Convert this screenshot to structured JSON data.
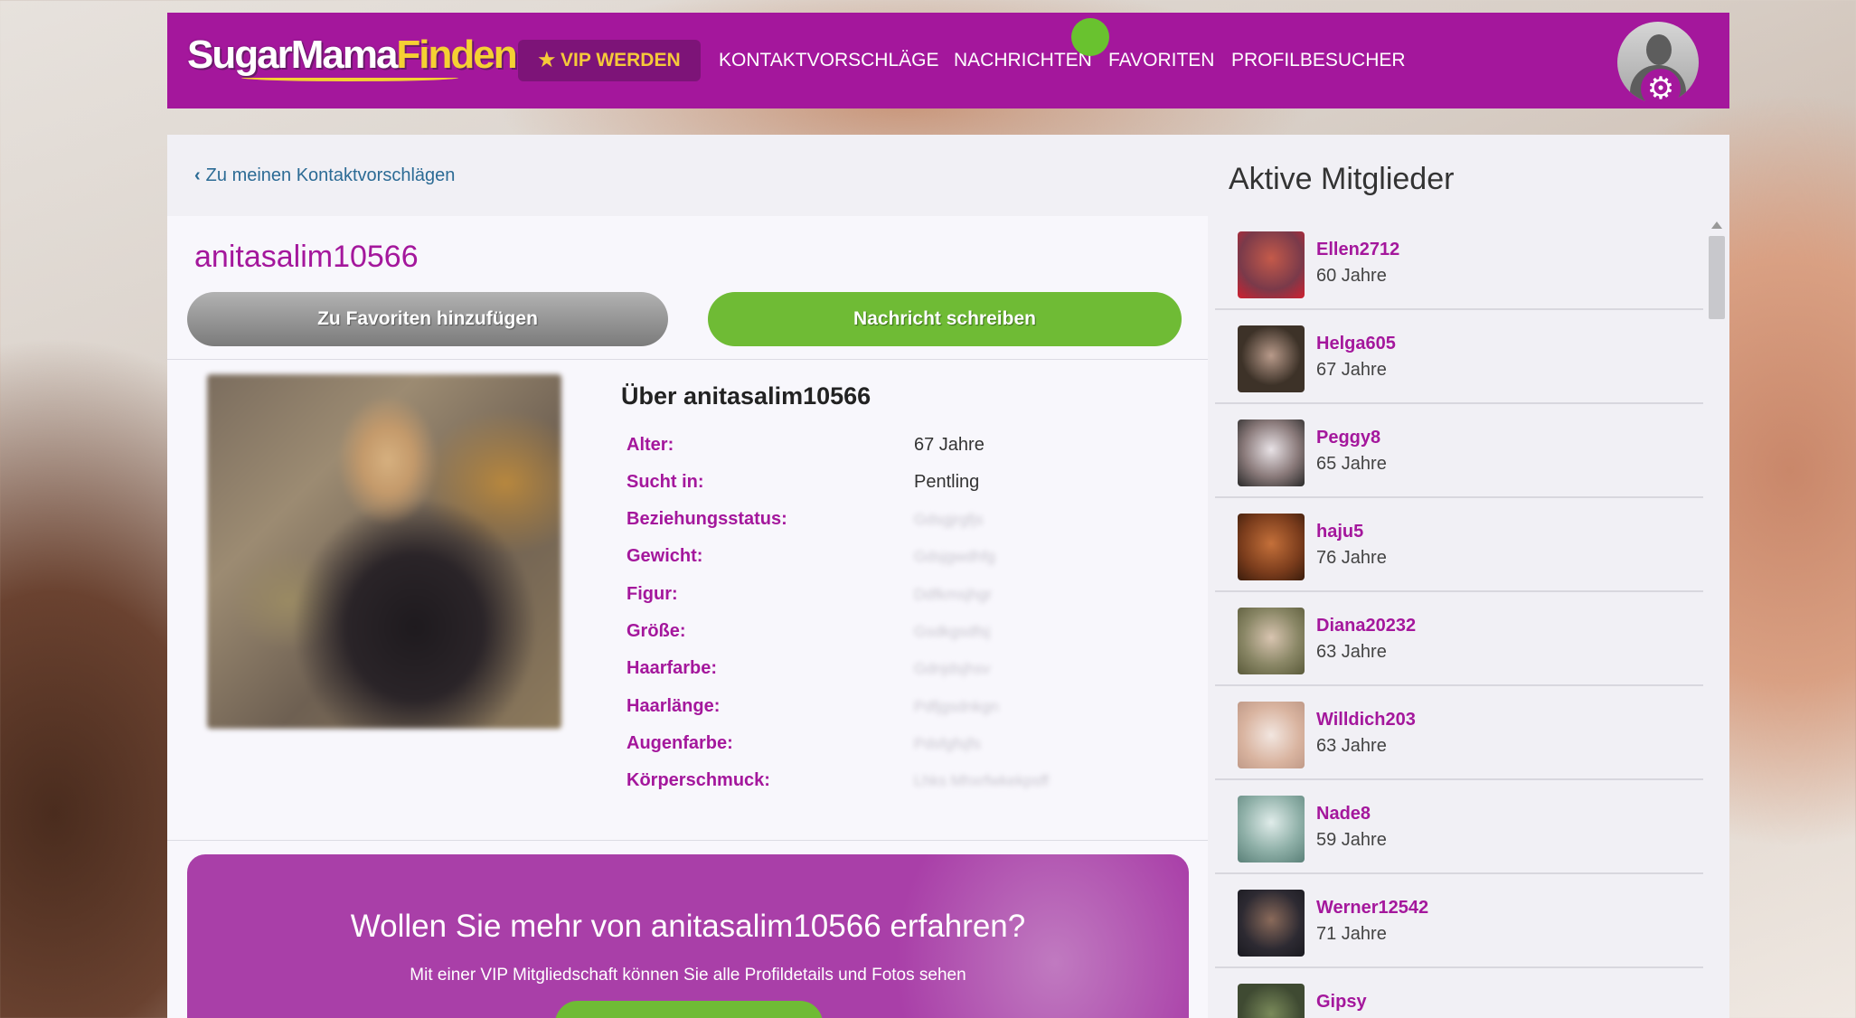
{
  "header": {
    "logo_part1": "SugarMama",
    "logo_part2": "Finden",
    "vip_label": "VIP WERDEN",
    "nav": [
      "KONTAKTVORSCHLÄGE",
      "NACHRICHTEN",
      "FAVORITEN",
      "PROFILBESUCHER"
    ]
  },
  "back_link": "Zu meinen Kontaktvorschlägen",
  "profile": {
    "username": "anitasalim10566",
    "fav_button": "Zu Favoriten hinzufügen",
    "msg_button": "Nachricht schreiben",
    "about_heading": "Über anitasalim10566",
    "fields": [
      {
        "label": "Alter:",
        "value": "67 Jahre"
      },
      {
        "label": "Sucht in:",
        "value": "Pentling"
      },
      {
        "label": "Beziehungsstatus:",
        "value": "Gdsgjrgfjs"
      },
      {
        "label": "Gewicht:",
        "value": "Gdsjgwdhfg"
      },
      {
        "label": "Figur:",
        "value": "Ddfkmsjhgr"
      },
      {
        "label": "Größe:",
        "value": "Gsdkgsdfsj"
      },
      {
        "label": "Haarfarbe:",
        "value": "Gdnjdsjhsv"
      },
      {
        "label": "Haarlänge:",
        "value": "Pdfjgsdnkgn"
      },
      {
        "label": "Augenfarbe:",
        "value": "Pdsfgfsjfs"
      },
      {
        "label": "Körperschmuck:",
        "value": "Lhks Mhxrfwkekpsff"
      }
    ]
  },
  "promo": {
    "heading": "Wollen Sie mehr von anitasalim10566 erfahren?",
    "text": "Mit einer VIP Mitgliedschaft können Sie alle Profildetails und Fotos sehen"
  },
  "sidebar": {
    "title": "Aktive Mitglieder",
    "members": [
      {
        "name": "Ellen2712",
        "age": "60 Jahre",
        "color": "#7a3a4a"
      },
      {
        "name": "Helga605",
        "age": "67 Jahre",
        "color": "#3d3228"
      },
      {
        "name": "Peggy8",
        "age": "65 Jahre",
        "color": "#8a7a7a"
      },
      {
        "name": "haju5",
        "age": "76 Jahre",
        "color": "#7a3c1c"
      },
      {
        "name": "Diana20232",
        "age": "63 Jahre",
        "color": "#8a8766"
      },
      {
        "name": "Willdich203",
        "age": "63 Jahre",
        "color": "#d9b4a0"
      },
      {
        "name": "Nade8",
        "age": "59 Jahre",
        "color": "#8fb0a8"
      },
      {
        "name": "Werner12542",
        "age": "71 Jahre",
        "color": "#2d2a32"
      },
      {
        "name": "Gipsy",
        "age": "",
        "color": "#3f4a32"
      }
    ]
  },
  "colors": {
    "brand": "#a4179c",
    "accent_green": "#6fbb35",
    "vip_gold": "#f5c93a"
  }
}
